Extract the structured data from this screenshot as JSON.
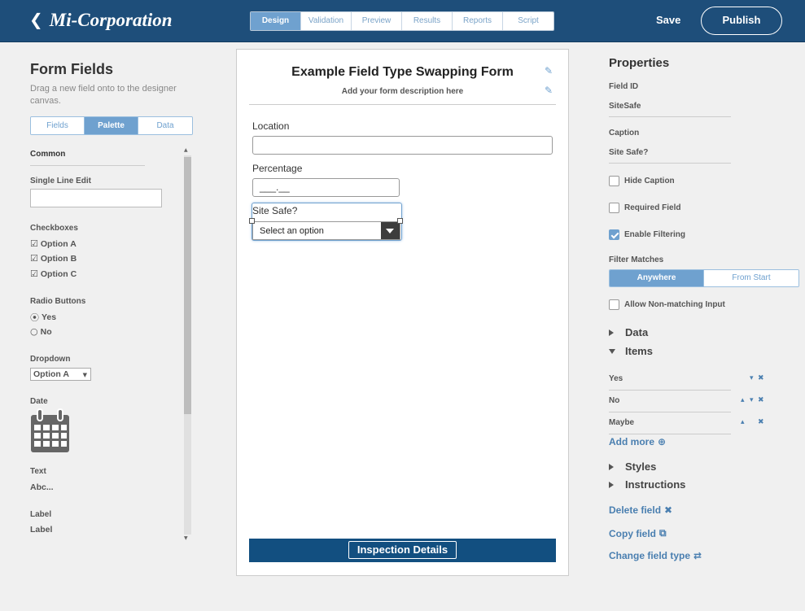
{
  "header": {
    "logo": "Mi-Corporation",
    "tabs": [
      "Design",
      "Validation",
      "Preview",
      "Results",
      "Reports",
      "Script"
    ],
    "active_tab": "Design",
    "save_label": "Save",
    "publish_label": "Publish"
  },
  "left": {
    "title": "Form Fields",
    "hint": "Drag a new field onto to the designer canvas.",
    "tabs": [
      "Fields",
      "Palette",
      "Data"
    ],
    "active_tab": "Palette",
    "common": "Common",
    "single_line": "Single Line Edit",
    "checkboxes": "Checkboxes",
    "checkbox_opts": [
      "Option A",
      "Option B",
      "Option C"
    ],
    "radio": "Radio Buttons",
    "radio_opts": [
      "Yes",
      "No"
    ],
    "dropdown": "Dropdown",
    "dropdown_value": "Option A",
    "date": "Date",
    "text": "Text",
    "text_sample": "Abc...",
    "label": "Label",
    "label_sample": "Label"
  },
  "canvas": {
    "title": "Example Field Type Swapping Form",
    "description": "Add your form description here",
    "location_label": "Location",
    "percentage_label": "Percentage",
    "percentage_mask": "___.__",
    "site_safe_label": "Site Safe?",
    "select_placeholder": "Select an option",
    "footer_button": "Inspection Details"
  },
  "properties": {
    "title": "Properties",
    "field_id_label": "Field ID",
    "field_id_value": "SiteSafe",
    "caption_label": "Caption",
    "caption_value": "Site Safe?",
    "hide_caption": "Hide Caption",
    "required_field": "Required Field",
    "enable_filtering": "Enable Filtering",
    "hide_caption_checked": false,
    "required_checked": false,
    "filtering_checked": true,
    "filter_matches": "Filter Matches",
    "filter_options": [
      "Anywhere",
      "From Start"
    ],
    "filter_active": "Anywhere",
    "allow_nonmatching": "Allow Non-matching Input",
    "allow_checked": false,
    "data_section": "Data",
    "items_section": "Items",
    "items": [
      "Yes",
      "No",
      "Maybe"
    ],
    "add_more": "Add more",
    "styles_section": "Styles",
    "instructions_section": "Instructions",
    "delete_field": "Delete field",
    "copy_field": "Copy field",
    "change_field_type": "Change field type"
  },
  "colors": {
    "header_bg": "#1e4e7a",
    "accent": "#6fa1cf",
    "link": "#4a7fb0",
    "footer_bar": "#124f80"
  }
}
